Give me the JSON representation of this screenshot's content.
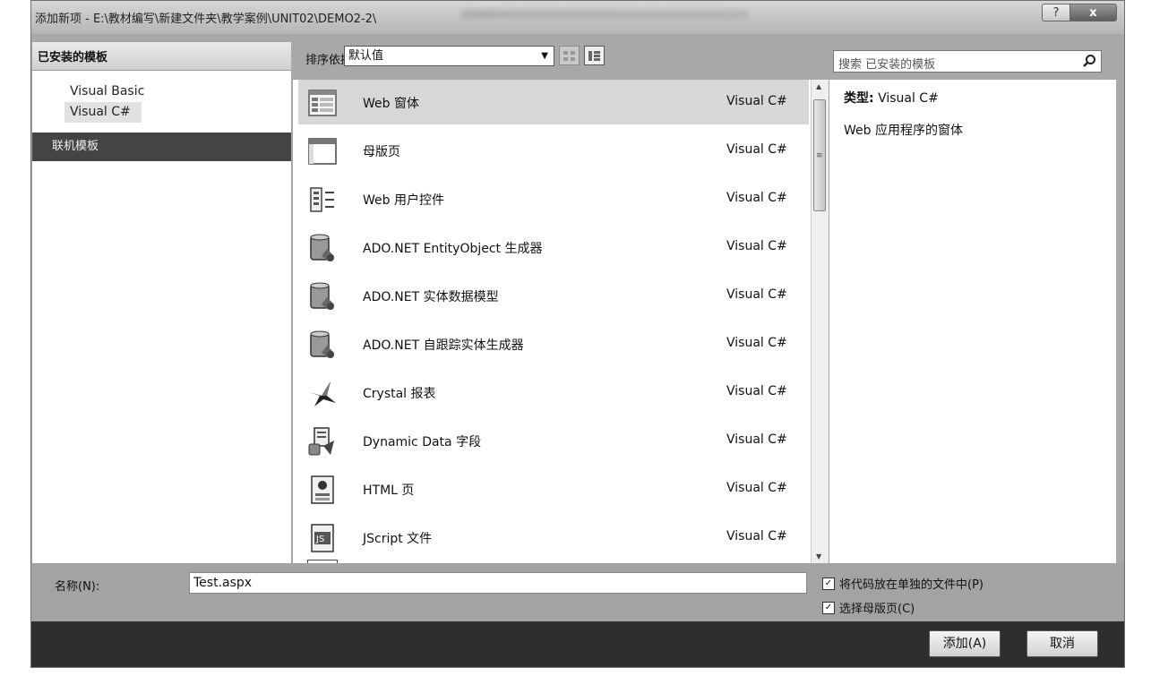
{
  "window": {
    "title": "添加新项 - E:\\教材编写\\新建文件夹\\教学案例\\UNIT02\\DEMO2-2\\",
    "help_label": "?",
    "close_label": "x"
  },
  "left": {
    "header": "已安装的模板",
    "tree": [
      {
        "label": "Visual Basic"
      },
      {
        "label": "Visual C#"
      }
    ],
    "online": "联机模板"
  },
  "toolbar": {
    "sort_label": "排序依据:",
    "sort_value": "默认值"
  },
  "search": {
    "placeholder": "搜索 已安装的模板"
  },
  "templates": [
    {
      "name": "Web 窗体",
      "type": "Visual C#",
      "icon": "web-form-icon"
    },
    {
      "name": "母版页",
      "type": "Visual C#",
      "icon": "master-page-icon"
    },
    {
      "name": "Web 用户控件",
      "type": "Visual C#",
      "icon": "user-control-icon"
    },
    {
      "name": "ADO.NET EntityObject 生成器",
      "type": "Visual C#",
      "icon": "database-icon"
    },
    {
      "name": "ADO.NET 实体数据模型",
      "type": "Visual C#",
      "icon": "database-icon"
    },
    {
      "name": "ADO.NET 自跟踪实体生成器",
      "type": "Visual C#",
      "icon": "database-icon"
    },
    {
      "name": "Crystal 报表",
      "type": "Visual C#",
      "icon": "crystal-report-icon"
    },
    {
      "name": "Dynamic Data 字段",
      "type": "Visual C#",
      "icon": "dynamic-data-icon"
    },
    {
      "name": "HTML 页",
      "type": "Visual C#",
      "icon": "html-page-icon"
    },
    {
      "name": "JScript 文件",
      "type": "Visual C#",
      "icon": "jscript-file-icon"
    }
  ],
  "description": {
    "type_label": "类型:",
    "type_value": "Visual C#",
    "text": "Web 应用程序的窗体"
  },
  "form": {
    "name_label": "名称(N):",
    "name_value": "Test.aspx",
    "option1": "将代码放在单独的文件中(P)",
    "option2": "选择母版页(C)"
  },
  "buttons": {
    "add": "添加(A)",
    "cancel": "取消"
  }
}
